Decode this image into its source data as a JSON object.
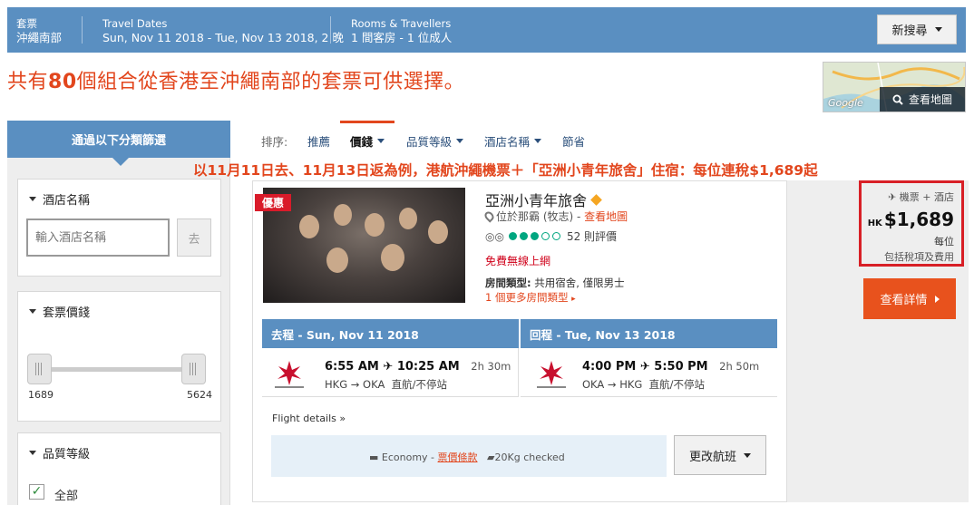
{
  "search_bar": {
    "package_label": "套票",
    "package_value": "沖繩南部",
    "dates_label": "Travel Dates",
    "dates_value": "Sun, Nov 11 2018 - Tue, Nov 13 2018, 2 晚",
    "rooms_label": "Rooms & Travellers",
    "rooms_value": "1 間客房 - 1 位成人",
    "new_search": "新搜尋"
  },
  "title": {
    "prefix": "共有",
    "count": "80",
    "suffix": "個組合從香港至沖繩南部的套票可供選擇。"
  },
  "map": {
    "button": "查看地圖",
    "google": "Google"
  },
  "sidebar": {
    "header": "通過以下分類篩選",
    "hotel_name": {
      "title": "酒店名稱",
      "placeholder": "輸入酒店名稱",
      "go": "去"
    },
    "price": {
      "title": "套票價錢",
      "min": "1689",
      "max": "5624"
    },
    "quality": {
      "title": "品質等級",
      "option_all": "全部"
    }
  },
  "sort": {
    "label": "排序:",
    "items": [
      "推薦",
      "價錢",
      "品質等級",
      "酒店名稱",
      "節省"
    ]
  },
  "annotation": "以11月11日去、11月13日返為例，港航沖繩機票＋「亞洲小青年旅舍」住宿：每位連稅$1,689起",
  "result": {
    "deal": "優惠",
    "hotel_name": "亞洲小青年旅舍",
    "location": "位於那霸 (牧志) - ",
    "map_link": "查看地圖",
    "reviews": "52 則評價",
    "rating_bubbles": 3,
    "wifi": "免費無線上網",
    "room_type_label": "房間類型:",
    "room_type_value": " 共用宿舍, 僅限男士",
    "more_rooms": "1 個更多房間類型",
    "outbound": {
      "header": "去程 - Sun, Nov 11 2018",
      "depart": "6:55 AM",
      "arrive": "10:25 AM",
      "duration": "2h 30m",
      "route": "HKG → OKA",
      "stops": "直航/不停站"
    },
    "return": {
      "header": "回程 - Tue, Nov 13 2018",
      "depart": "4:00 PM",
      "arrive": "5:50 PM",
      "duration": "2h 50m",
      "route": "OKA → HKG",
      "stops": "直航/不停站"
    },
    "flight_details": "Flight details »",
    "fare": {
      "cabin": "Economy - ",
      "rules": "票價條款",
      "baggage": "20Kg checked"
    },
    "change_flight": "更改航班",
    "price_box": {
      "package": "機票 + 酒店",
      "currency": "HK",
      "price": "$1,689",
      "per": "每位",
      "incl": "包括稅項及費用"
    },
    "details_button": "查看詳情"
  },
  "colors": {
    "accent": "#e2461d",
    "bar": "#5a8fc1",
    "highlight": "#d81f26"
  }
}
